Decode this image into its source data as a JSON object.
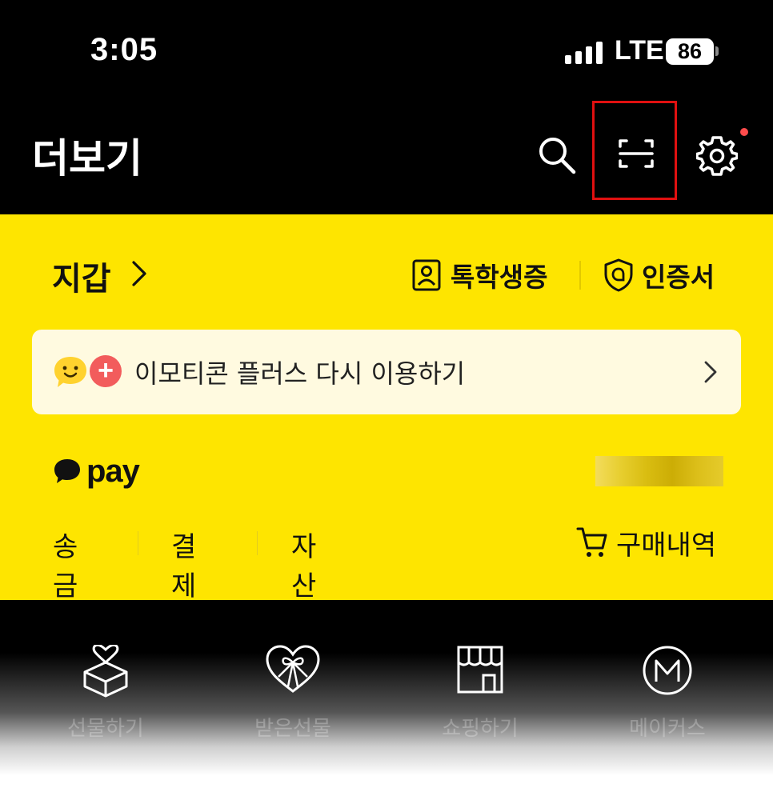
{
  "status_bar": {
    "time": "3:05",
    "network": "LTE",
    "battery": "86"
  },
  "header": {
    "title": "더보기",
    "icons": [
      "search-icon",
      "scan-icon",
      "settings-icon"
    ]
  },
  "wallet": {
    "title": "지갑",
    "student_id_label": "톡학생증",
    "certificate_label": "인증서",
    "emoticon_banner": {
      "label": "이모티콘 플러스 다시 이용하기",
      "badge": "+"
    },
    "pay": {
      "logo_text": "pay",
      "actions": [
        "송금",
        "결제",
        "자산"
      ],
      "purchase_history_label": "구매내역"
    }
  },
  "services": [
    {
      "label": "선물하기",
      "icon": "gift-box-heart-icon"
    },
    {
      "label": "받은선물",
      "icon": "heart-ribbon-icon"
    },
    {
      "label": "쇼핑하기",
      "icon": "store-icon"
    },
    {
      "label": "메이커스",
      "icon": "makers-m-icon"
    }
  ],
  "colors": {
    "accent_yellow": "#FEE500",
    "header_bg": "#000000",
    "highlight_border": "#E01010"
  }
}
